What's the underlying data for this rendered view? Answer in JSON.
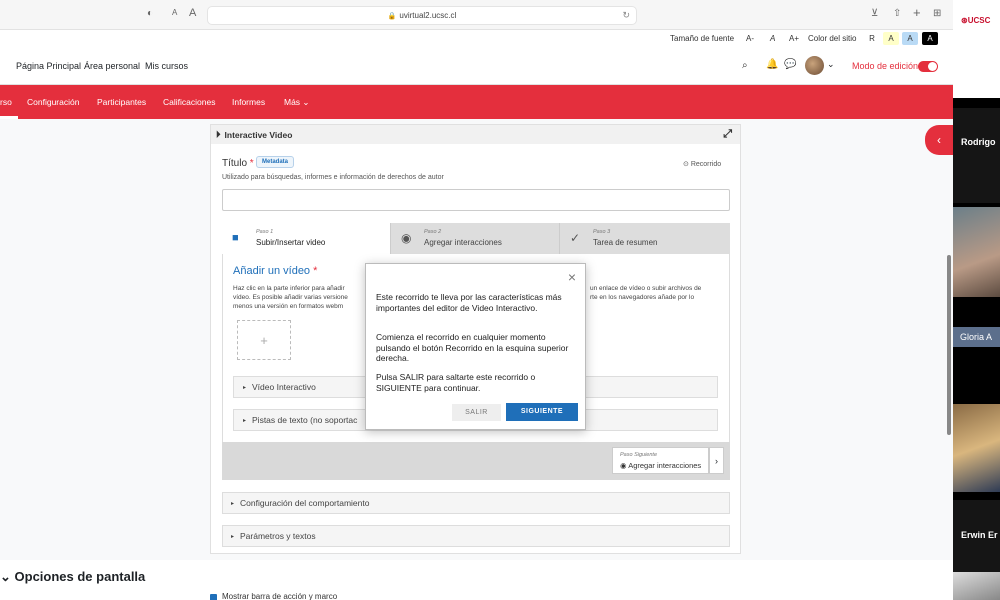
{
  "browser": {
    "url": "uvirtual2.ucsc.cl",
    "font_small": "A",
    "font_large": "A"
  },
  "a11y": {
    "font_label": "Tamaño de fuente",
    "dec": "A-",
    "normal": "A",
    "inc": "A+",
    "color_label": "Color del sitio",
    "r": "R",
    "a1": "A",
    "a2": "A",
    "a3": "A"
  },
  "nav": {
    "items": [
      "Página Principal",
      "Área personal",
      "Mis cursos"
    ],
    "edit_mode": "Modo de edición",
    "chevron": "⌄"
  },
  "course_nav": {
    "partial": "rso",
    "items": [
      "Configuración",
      "Participantes",
      "Calificaciones",
      "Informes"
    ],
    "more": "Más"
  },
  "editor": {
    "header": "Interactive Video",
    "title_label": "Título",
    "required": "*",
    "metadata": "Metadata",
    "tour": "Recorrido",
    "help": "Utilizado para búsquedas, informes e información de derechos de autor",
    "steps": [
      {
        "num": "Paso 1",
        "title": "Subir/Insertar video"
      },
      {
        "num": "Paso 2",
        "title": "Agregar interacciones"
      },
      {
        "num": "Paso 3",
        "title": "Tarea de resumen"
      }
    ],
    "add_video": "Añadir un vídeo",
    "desc_left": [
      "Haz clic en la parte inferior para añadir",
      "vídeo. Es posible añadir varias versione",
      "menos una versión en formatos webm"
    ],
    "desc_right": [
      "un enlace de vídeo o subir archivos de",
      "rte en los navegadores añade por lo"
    ],
    "plus": "+",
    "video_interactivo": "Vídeo Interactivo",
    "pistas": "Pistas de texto (no soportac",
    "next_step_label": "Paso Siguiente",
    "next_step": "Agregar interacciones",
    "config": "Configuración del comportamiento",
    "params": "Parámetros y textos"
  },
  "tour_modal": {
    "p1": "Este recorrido te lleva por las características más importantes del editor de Video Interactivo.",
    "p2": "Comienza el recorrido en cualquier momento pulsando el botón Recorrido en la esquina superior derecha.",
    "p3": "Pulsa SALIR para saltarte este recorrido o SIGUIENTE para continuar.",
    "skip": "SALIR",
    "next": "SIGUIENTE",
    "close": "×"
  },
  "screen_options": {
    "title": "Opciones de pantalla",
    "checkbox": "Mostrar barra de acción y marco"
  },
  "participants": [
    "Rodrigo",
    "Gloria A",
    "Erwin Er"
  ],
  "logo": "UCSC",
  "colors": {
    "brand": "#e42f3d",
    "primary": "#1f6fb9"
  }
}
